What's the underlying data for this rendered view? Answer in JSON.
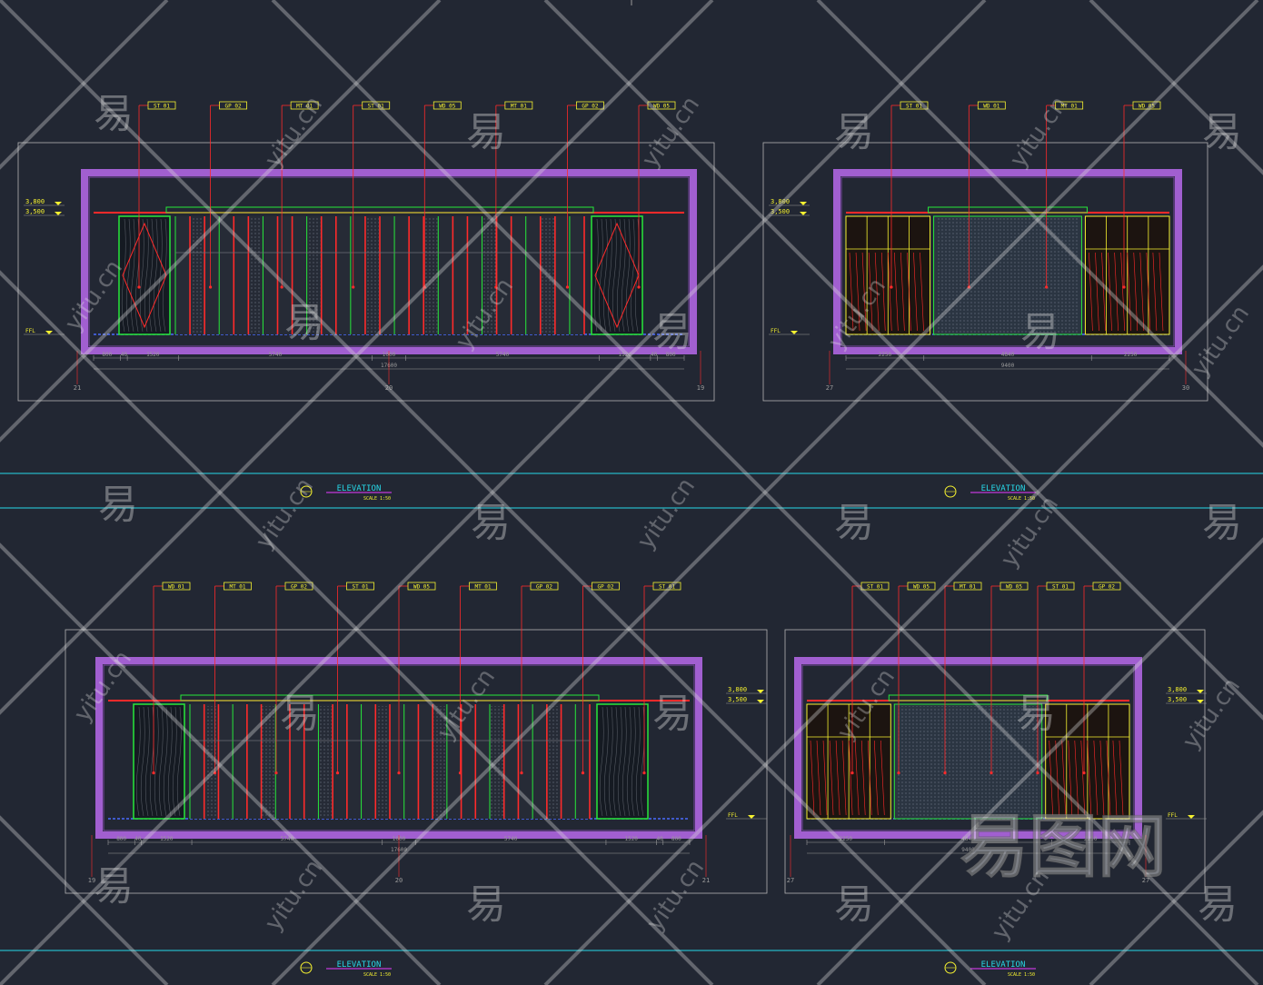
{
  "sheets": [
    {
      "id": "top-left",
      "title": "ELEVATION",
      "scale": "SCALE 1:50",
      "levels": [
        "3,800",
        "3,500"
      ],
      "ffl": "FFL",
      "dims": [
        "800",
        "40",
        "1520",
        "5740",
        "1000",
        "5740",
        "1520",
        "40",
        "800"
      ],
      "total": "17600",
      "grids": [
        "21",
        "20",
        "19"
      ],
      "tags": [
        "ST 01",
        "GP 02",
        "MT 01",
        "ST 01",
        "WD 05",
        "MT 01",
        "GP 02",
        "WD 05"
      ]
    },
    {
      "id": "top-right",
      "title": "ELEVATION",
      "scale": "SCALE 1:50",
      "levels": [
        "3,800",
        "3,500"
      ],
      "ffl": "FFL",
      "dims": [
        "2250",
        "4840",
        "2250"
      ],
      "total": "9400",
      "grids": [
        "27",
        "30"
      ],
      "tags": [
        "ST 01",
        "WD 01",
        "MT 01",
        "WD 05"
      ]
    },
    {
      "id": "bottom-left",
      "title": "ELEVATION",
      "scale": "SCALE 1:50",
      "levels": [
        "3,800",
        "3,500"
      ],
      "ffl": "FFL",
      "dims": [
        "800",
        "40",
        "1520",
        "5740",
        "1000",
        "5740",
        "1520",
        "40",
        "800"
      ],
      "total": "17600",
      "grids": [
        "19",
        "20",
        "21"
      ],
      "tags": [
        "WD 01",
        "MT 01",
        "GP 02",
        "ST 01",
        "WD 05",
        "MT 01",
        "GP 02",
        "GP 02",
        "ST 01"
      ]
    },
    {
      "id": "bottom-right",
      "title": "ELEVATION",
      "scale": "SCALE 1:50",
      "levels": [
        "3,800",
        "3,500"
      ],
      "ffl": "FFL",
      "dims": [
        "2250",
        "4840",
        "2250"
      ],
      "total": "9400",
      "grids": [
        "27",
        "27"
      ],
      "tags": [
        "ST 01",
        "WD 05",
        "MT 01",
        "WD 05",
        "ST 01",
        "GP 02"
      ]
    }
  ],
  "watermark": {
    "logo_text": "易图网",
    "char": "易",
    "domain": "yitu.cn"
  },
  "colors": {
    "background": "#222733",
    "frame": "#b3b3b3",
    "magenta_wall": "#a15fd0",
    "red": "#ff2a2a",
    "green": "#27e83a",
    "yellow": "#f6f230",
    "cyan": "#27d8e8",
    "gray": "#9a9a9a"
  }
}
